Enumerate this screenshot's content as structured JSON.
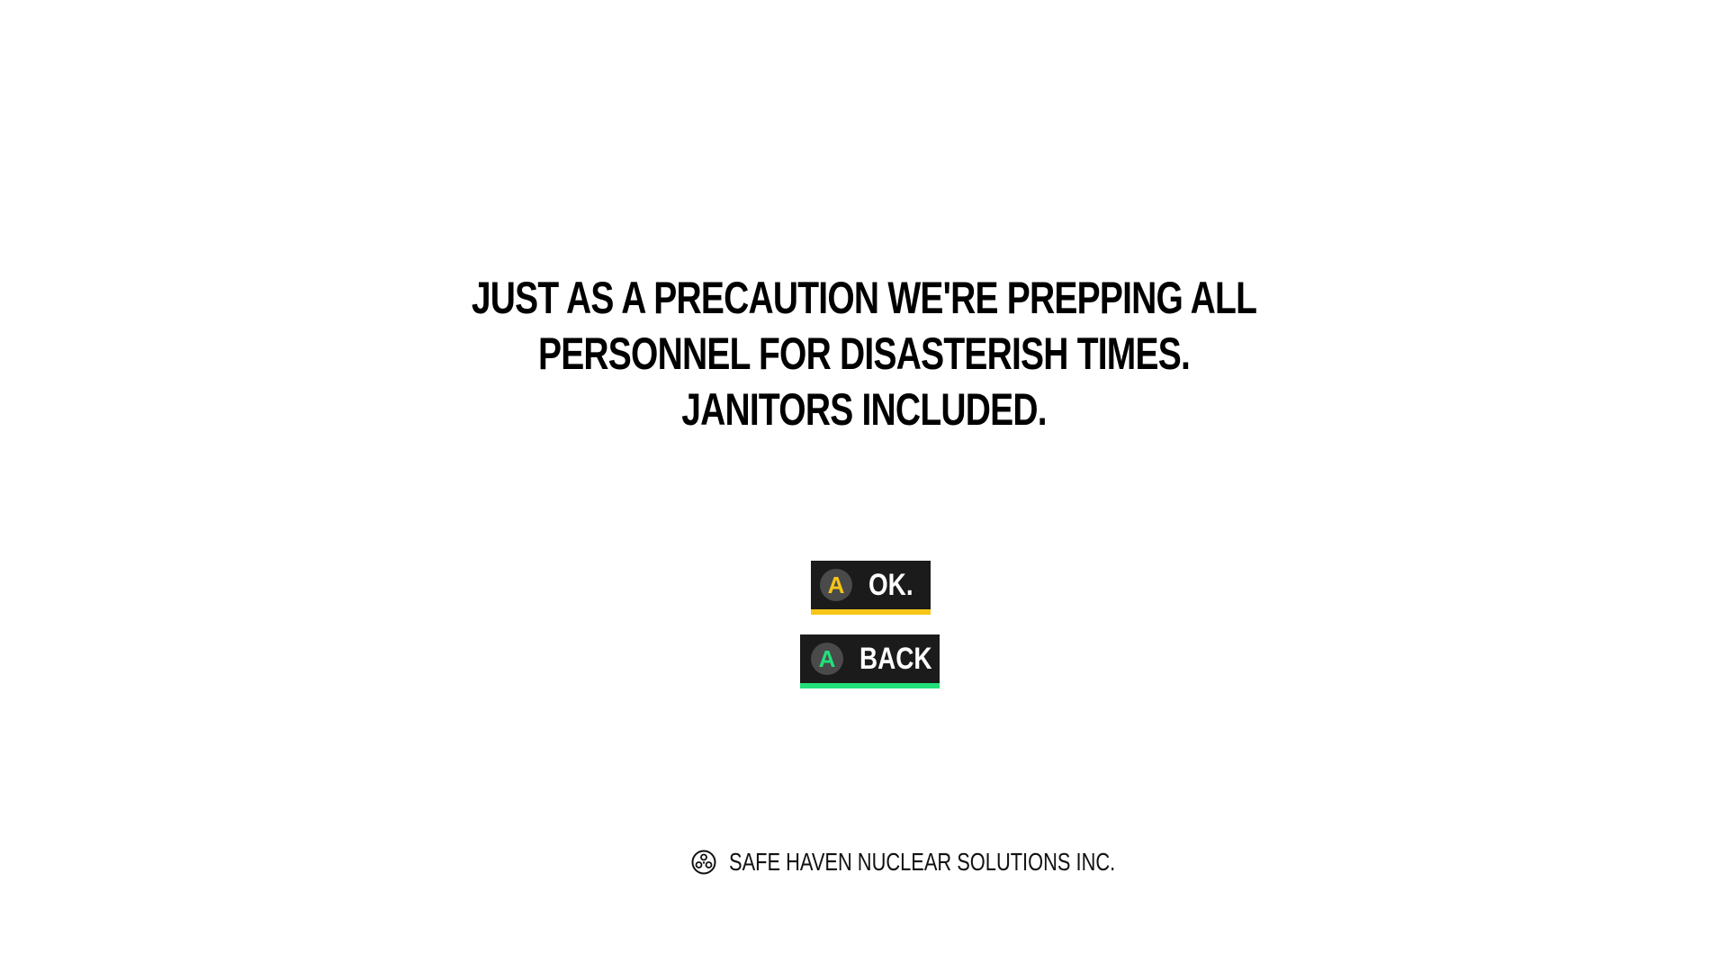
{
  "dialog": {
    "message_lines": [
      "JUST AS A PRECAUTION WE'RE PREPPING ALL",
      "PERSONNEL FOR DISASTERISH TIMES.",
      "JANITORS INCLUDED."
    ]
  },
  "buttons": {
    "ok": {
      "key": "A",
      "label": "OK.",
      "accent_color": "#f5c518",
      "icon": "a-button-icon"
    },
    "back": {
      "key": "A",
      "label": "BACK",
      "accent_color": "#22e07a",
      "icon": "a-button-icon"
    }
  },
  "footer": {
    "icon": "radiation-logo-icon",
    "text": "SAFE HAVEN NUCLEAR SOLUTIONS INC."
  },
  "colors": {
    "background": "#ffffff",
    "text": "#000000",
    "button_background": "#1b1b1b"
  }
}
